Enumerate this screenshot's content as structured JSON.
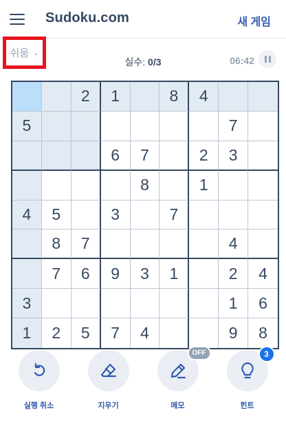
{
  "header": {
    "logo": "Sudoku.com",
    "new_game": "새 게임"
  },
  "status": {
    "difficulty": "쉬움",
    "mistakes_label": "실수:",
    "mistakes_value": "0/3",
    "timer": "06:42"
  },
  "board": {
    "rows": [
      [
        "",
        "",
        "2",
        "1",
        "",
        "8",
        "4",
        "",
        ""
      ],
      [
        "5",
        "",
        "",
        "",
        "",
        "",
        "",
        "7",
        ""
      ],
      [
        "",
        "",
        "",
        "6",
        "7",
        "",
        "2",
        "3",
        ""
      ],
      [
        "",
        "",
        "",
        "",
        "8",
        "",
        "1",
        "",
        ""
      ],
      [
        "4",
        "5",
        "",
        "3",
        "",
        "7",
        "",
        "",
        ""
      ],
      [
        "",
        "8",
        "7",
        "",
        "",
        "",
        "",
        "4",
        ""
      ],
      [
        "",
        "7",
        "6",
        "9",
        "3",
        "1",
        "",
        "2",
        "4"
      ],
      [
        "3",
        "",
        "",
        "",
        "",
        "",
        "",
        "1",
        "6"
      ],
      [
        "1",
        "2",
        "5",
        "7",
        "4",
        "",
        "",
        "9",
        "8"
      ]
    ],
    "selected": [
      0,
      0
    ]
  },
  "actions": {
    "undo": "실행 취소",
    "erase": "지우기",
    "notes": "메모",
    "notes_badge": "OFF",
    "hint": "힌트",
    "hint_badge": "3"
  },
  "colors": {
    "accent": "#325aaf",
    "selected_cell": "#bbdefb",
    "highlight_cell": "#e2ebf3",
    "error_outline": "#e8141e"
  },
  "icons": {
    "menu": "hamburger-icon",
    "pause": "pause-icon",
    "undo": "undo-icon",
    "erase": "eraser-icon",
    "notes": "pencil-icon",
    "hint": "lightbulb-icon"
  }
}
